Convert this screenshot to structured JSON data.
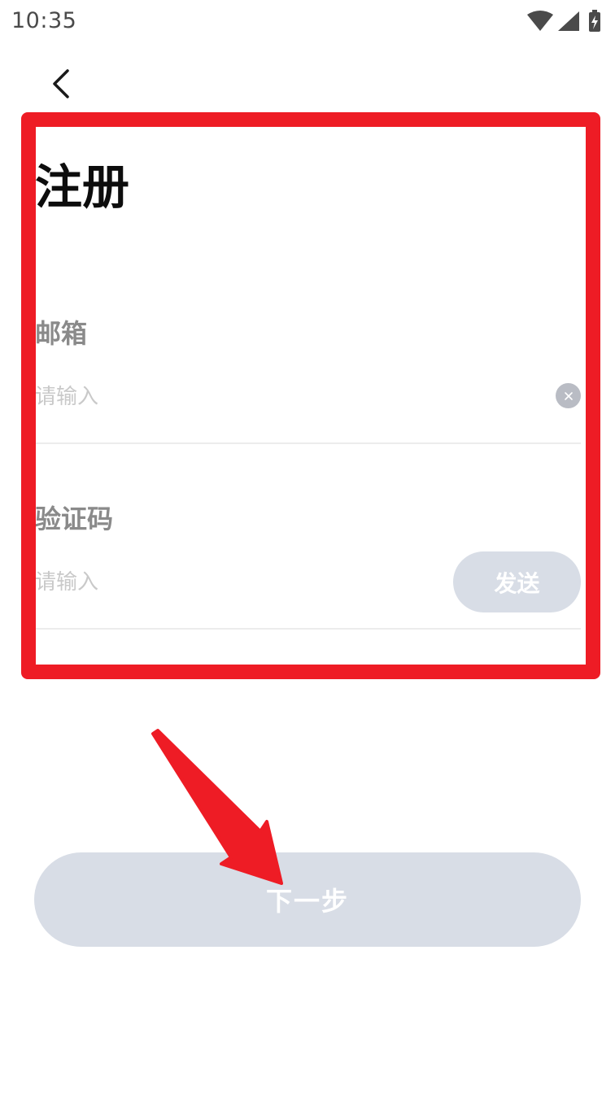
{
  "status_bar": {
    "time": "10:35",
    "icons": [
      "wifi-icon",
      "signal-icon",
      "battery-charging-icon"
    ]
  },
  "header": {
    "back_icon": "chevron-left-icon"
  },
  "page": {
    "title": "注册"
  },
  "form": {
    "email": {
      "label": "邮箱",
      "value": "",
      "placeholder": "请输入",
      "clear_icon": "clear-icon"
    },
    "code": {
      "label": "验证码",
      "value": "",
      "placeholder": "请输入",
      "send_label": "发送"
    }
  },
  "actions": {
    "next_label": "下一步"
  },
  "annotation": {
    "frame_color": "#ee1c25",
    "arrow_color": "#ee1c25"
  },
  "colors": {
    "button_disabled": "#d8dde6",
    "label_gray": "#8a8a8a",
    "placeholder_gray": "#c9c9c9"
  }
}
